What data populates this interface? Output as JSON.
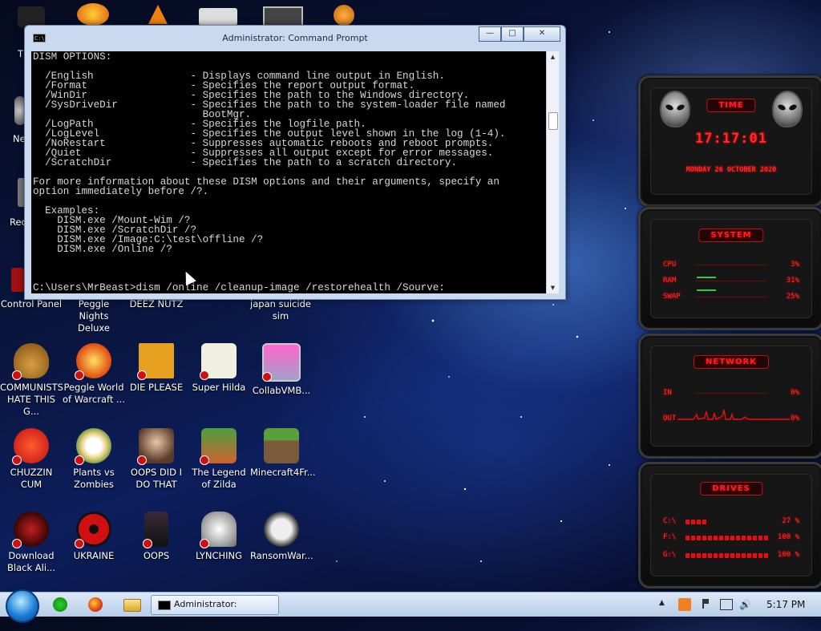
{
  "desktop": {
    "partial_labels": [
      "Th",
      "Ne",
      "Rec"
    ],
    "icons": [
      {
        "label": "Control Panel",
        "color": "#8a1a1a"
      },
      {
        "label": "Peggle Nights Deluxe",
        "color": "#c4d4ee"
      },
      {
        "label": "DEEZ NUTZ",
        "color": "#d0e0f0"
      },
      {
        "label": "japan suicide sim",
        "color": "#334466"
      },
      {
        "label": "COMMUNISTS HATE THIS G...",
        "color": "#b07a30"
      },
      {
        "label": "Peggle World of Warcraft ...",
        "color": "#e04a10"
      },
      {
        "label": "DIE PLEASE",
        "color": "#e8a020"
      },
      {
        "label": "Super Hilda",
        "color": "#e8e8d8"
      },
      {
        "label": "CollabVMB...",
        "color": "#d9d9e8"
      },
      {
        "label": "CHUZZIN CUM",
        "color": "#e02010"
      },
      {
        "label": "Plants vs Zombies",
        "color": "#e8e0c0"
      },
      {
        "label": "OOPS DID I DO THAT",
        "color": "#7a5a4a"
      },
      {
        "label": "The Legend of Zilda",
        "color": "#4aa040"
      },
      {
        "label": "Minecraft4Fr...",
        "color": "#5a7a3a"
      },
      {
        "label": "Download Black Ali...",
        "color": "#6a1010"
      },
      {
        "label": "UKRAINE",
        "color": "#d01010"
      },
      {
        "label": "OOPS",
        "color": "#3a2a3a"
      },
      {
        "label": "LYNCHING",
        "color": "#d8d8d8"
      },
      {
        "label": "RansomWar...",
        "color": "#c8c8c8"
      }
    ]
  },
  "cmd": {
    "title": "Administrator: Command Prompt",
    "icon_text": "C:\\",
    "buttons": {
      "minimize": "—",
      "maximize": "□",
      "close": "✕"
    },
    "lines": [
      "DISM OPTIONS:",
      "",
      "  /English                - Displays command line output in English.",
      "  /Format                 - Specifies the report output format.",
      "  /WinDir                 - Specifies the path to the Windows directory.",
      "  /SysDriveDir            - Specifies the path to the system-loader file named",
      "                            BootMgr.",
      "  /LogPath                - Specifies the logfile path.",
      "  /LogLevel               - Specifies the output level shown in the log (1-4).",
      "  /NoRestart              - Suppresses automatic reboots and reboot prompts.",
      "  /Quiet                  - Suppresses all output except for error messages.",
      "  /ScratchDir             - Specifies the path to a scratch directory.",
      "",
      "For more information about these DISM options and their arguments, specify an",
      "option immediately before /?.",
      "",
      "  Examples:",
      "    DISM.exe /Mount-Wim /?",
      "    DISM.exe /ScratchDir /?",
      "    DISM.exe /Image:C:\\test\\offline /?",
      "    DISM.exe /Online /?",
      "",
      "",
      "",
      "C:\\Users\\MrBeast>dism /online /cleanup-image /restorehealth /Sourve:"
    ]
  },
  "gadgets": {
    "time": {
      "header": "TIME",
      "clock": "17:17:01",
      "date": "MONDAY 26 OCTOBER 2020"
    },
    "system": {
      "header": "SYSTEM",
      "rows": [
        {
          "label": "CPU",
          "value": "3%"
        },
        {
          "label": "RAM",
          "value": "31%"
        },
        {
          "label": "SWAP",
          "value": "25%"
        }
      ]
    },
    "network": {
      "header": "NETWORK",
      "rows": [
        {
          "label": "IN",
          "value": "0%"
        },
        {
          "label": "OUT",
          "value": "0%"
        }
      ]
    },
    "drives": {
      "header": "DRIVES",
      "rows": [
        {
          "label": "C:\\",
          "value": "27 %"
        },
        {
          "label": "F:\\",
          "value": "100 %"
        },
        {
          "label": "G:\\",
          "value": "100 %"
        }
      ]
    }
  },
  "taskbar": {
    "task_label": "Administrator: Comma...",
    "clock": "5:17 PM",
    "tray_arrow": "▲"
  }
}
